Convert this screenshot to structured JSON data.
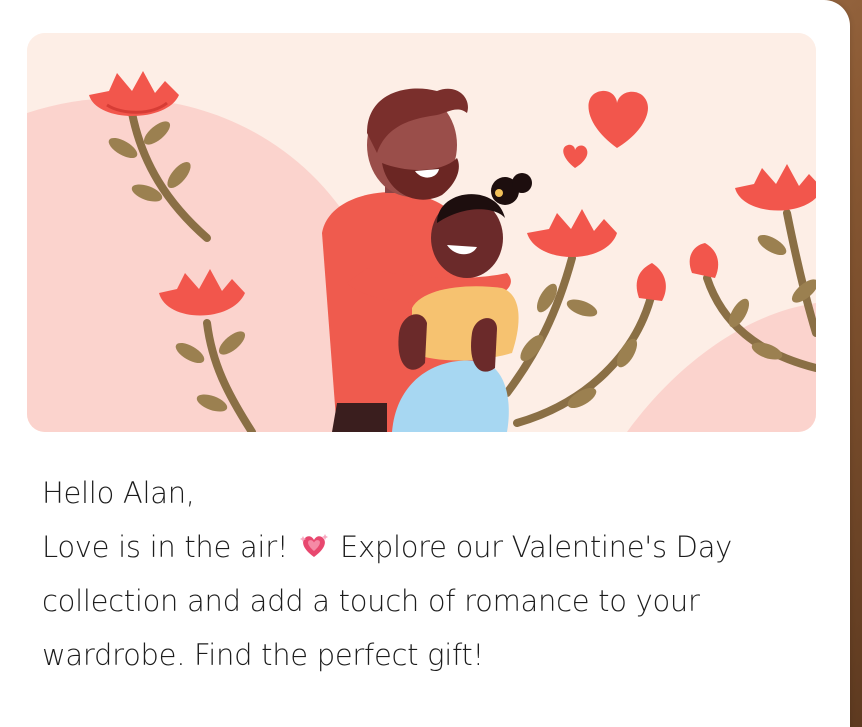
{
  "email": {
    "greeting": "Hello Alan,",
    "body_before_emoji": "Love is in the air! ",
    "emoji": "sparkling-heart-icon",
    "body_after_emoji": " Explore our Valentine's Day collection and add a touch of romance to your wardrobe. Find the perfect gift!"
  },
  "colors": {
    "banner_bg": "#fdeee6",
    "hill": "#fbd3cd",
    "flower": "#f2564c",
    "stem": "#8a6f45",
    "text": "#1c1c1c"
  }
}
